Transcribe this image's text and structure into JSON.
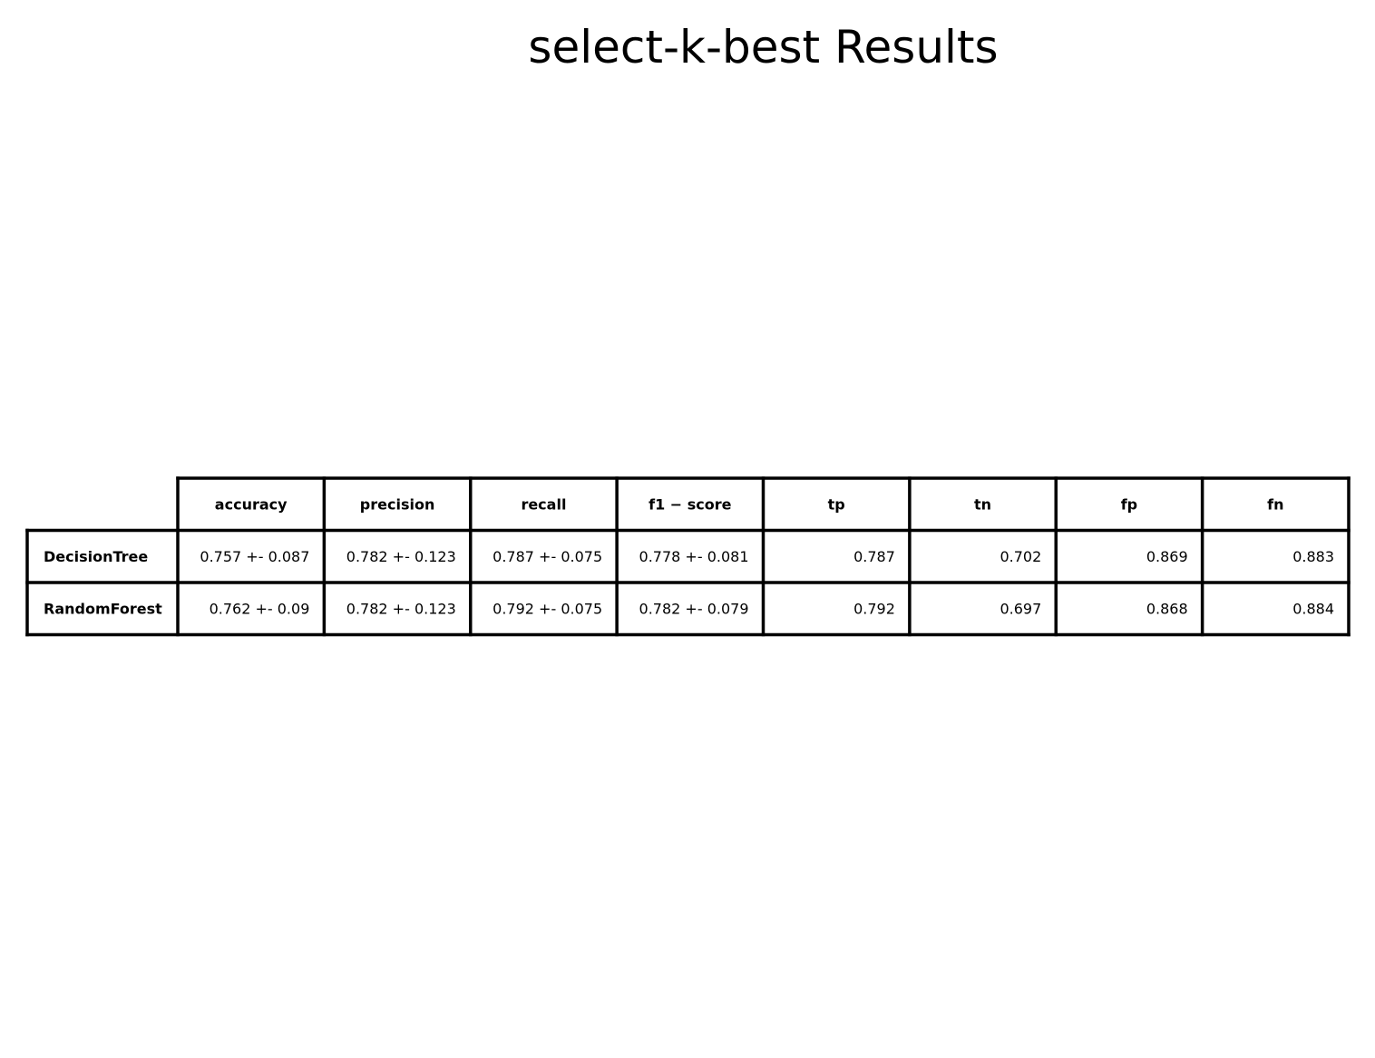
{
  "chart_data": {
    "type": "table",
    "title": "select-k-best Results",
    "columns": [
      "accuracy",
      "precision",
      "recall",
      "f1 − score",
      "tp",
      "tn",
      "fp",
      "fn"
    ],
    "rows": [
      {
        "label": "DecisionTree",
        "cells": [
          "0.757 +- 0.087",
          "0.782 +- 0.123",
          "0.787 +- 0.075",
          "0.778 +- 0.081",
          "0.787",
          "0.702",
          "0.869",
          "0.883"
        ]
      },
      {
        "label": "RandomForest",
        "cells": [
          "0.762 +- 0.09",
          "0.782 +- 0.123",
          "0.792 +- 0.075",
          "0.782 +- 0.079",
          "0.792",
          "0.697",
          "0.868",
          "0.884"
        ]
      }
    ]
  }
}
